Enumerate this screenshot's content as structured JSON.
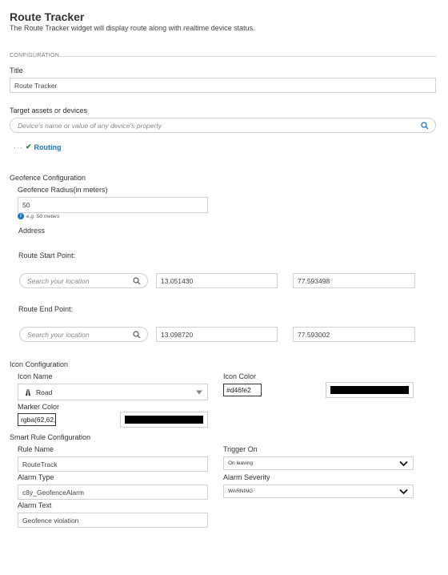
{
  "header": {
    "title": "Route Tracker",
    "subtitle": "The Route Tracker widget will display route along with realtime device status."
  },
  "configuration": {
    "legend": "CONFIGURATION",
    "title_label": "Title",
    "title_value": "Route Tracker",
    "target_label": "Target assets or devices",
    "target_placeholder": "Device's name or value of any device's property",
    "routing_item": "Routing"
  },
  "geofence": {
    "heading": "Geofence Configuration",
    "radius_label": "Geofence Radius(in meters)",
    "radius_value": "50",
    "radius_hint": "e.g. 50 meters",
    "address_label": "Address",
    "start": {
      "label": "Route Start Point:",
      "search_placeholder": "Search your location",
      "lat": "13.051430",
      "lng": "77.593498"
    },
    "end": {
      "label": "Route End Point:",
      "search_placeholder": "Search your location",
      "lat": "13.098720",
      "lng": "77.593002"
    }
  },
  "icon_config": {
    "heading": "Icon Configuration",
    "icon_name_label": "Icon Name",
    "icon_name_value": "Road",
    "icon_color_label": "Icon Color",
    "icon_color_value": "#d46fe2",
    "marker_color_label": "Marker Color",
    "marker_color_value": "rgba(62,62,"
  },
  "smart_rule": {
    "heading": "Smart Rule Configuration",
    "rule_name_label": "Rule Name",
    "rule_name_value": "RouteTrack",
    "trigger_label": "Trigger On",
    "trigger_value": "On leaving",
    "alarm_type_label": "Alarm Type",
    "alarm_type_value": "c8y_GeofenceAlarm",
    "severity_label": "Alarm Severity",
    "severity_value": "WARNING",
    "alarm_text_label": "Alarm Text",
    "alarm_text_value": "Geofence violation"
  },
  "colors": {
    "accent": "#1776bf",
    "check": "#1e8e3e",
    "swatch": "#000000"
  }
}
